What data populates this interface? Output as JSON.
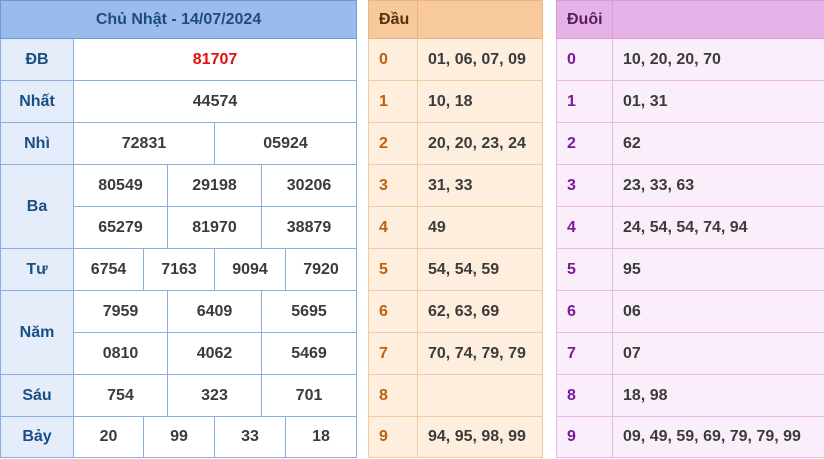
{
  "results": {
    "header": "Chủ Nhật - 14/07/2024",
    "rows": [
      {
        "label": "ĐB",
        "values": [
          "81707"
        ]
      },
      {
        "label": "Nhất",
        "values": [
          "44574"
        ]
      },
      {
        "label": "Nhì",
        "values": [
          "72831",
          "05924"
        ]
      },
      {
        "label": "Ba",
        "values": [
          "80549",
          "29198",
          "30206",
          "65279",
          "81970",
          "38879"
        ]
      },
      {
        "label": "Tư",
        "values": [
          "6754",
          "7163",
          "9094",
          "7920"
        ]
      },
      {
        "label": "Năm",
        "values": [
          "7959",
          "6409",
          "5695",
          "0810",
          "4062",
          "5469"
        ]
      },
      {
        "label": "Sáu",
        "values": [
          "754",
          "323",
          "701"
        ]
      },
      {
        "label": "Bảy",
        "values": [
          "20",
          "99",
          "33",
          "18"
        ]
      }
    ]
  },
  "dau": {
    "header": "Đầu",
    "rows": [
      {
        "digit": "0",
        "values": "01, 06, 07, 09"
      },
      {
        "digit": "1",
        "values": "10, 18"
      },
      {
        "digit": "2",
        "values": "20, 20, 23, 24"
      },
      {
        "digit": "3",
        "values": "31, 33"
      },
      {
        "digit": "4",
        "values": "49"
      },
      {
        "digit": "5",
        "values": "54, 54, 59"
      },
      {
        "digit": "6",
        "values": "62, 63, 69"
      },
      {
        "digit": "7",
        "values": "70, 74, 79, 79"
      },
      {
        "digit": "8",
        "values": ""
      },
      {
        "digit": "9",
        "values": "94, 95, 98, 99"
      }
    ]
  },
  "duoi": {
    "header": "Đuôi",
    "rows": [
      {
        "digit": "0",
        "values": "10, 20, 20, 70"
      },
      {
        "digit": "1",
        "values": "01, 31"
      },
      {
        "digit": "2",
        "values": "62"
      },
      {
        "digit": "3",
        "values": "23, 33, 63"
      },
      {
        "digit": "4",
        "values": "24, 54, 54, 74, 94"
      },
      {
        "digit": "5",
        "values": "95"
      },
      {
        "digit": "6",
        "values": "06"
      },
      {
        "digit": "7",
        "values": "07"
      },
      {
        "digit": "8",
        "values": "18, 98"
      },
      {
        "digit": "9",
        "values": "09, 49, 59, 69, 79, 79, 99"
      }
    ]
  },
  "colors": {
    "special_prize": "#e01010",
    "results_header": "#99bbee",
    "dau_header": "#f8c99a",
    "duoi_header": "#e7b2e7"
  }
}
